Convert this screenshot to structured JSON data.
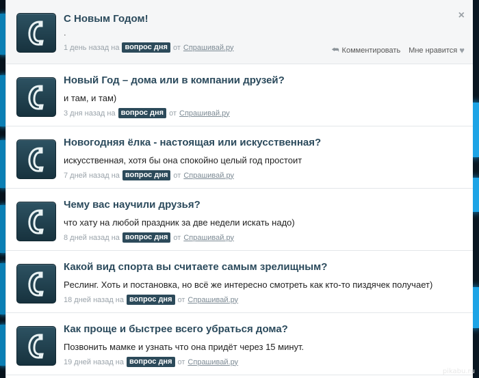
{
  "posts": [
    {
      "title": "С Новым Годом!",
      "answer": ".",
      "time": "1 день назад на",
      "tag": "вопрос дня",
      "from": "от",
      "source": "Спрашивай.ру",
      "close": "×",
      "comment_label": "Комментировать",
      "like_label": "Мне нравится"
    },
    {
      "title": "Новый Год – дома или в компании друзей?",
      "answer": "и там, и там)",
      "time": "3 дня назад на",
      "tag": "вопрос дня",
      "from": "от",
      "source": "Спрашивай.ру"
    },
    {
      "title": "Новогодняя ёлка - настоящая или искусственная?",
      "answer": "искусственная, хотя бы она спокойно целый год простоит",
      "time": "7 дней назад на",
      "tag": "вопрос дня",
      "from": "от",
      "source": "Спрашивай.ру"
    },
    {
      "title": "Чему вас научили друзья?",
      "answer": "что хату на любой праздник за две недели искать надо)",
      "time": "8 дней назад на",
      "tag": "вопрос дня",
      "from": "от",
      "source": "Спрашивай.ру"
    },
    {
      "title": "Какой вид спорта вы считаете самым зрелищным?",
      "answer": "Рeслинг. Хоть и постановка, но всё же интересно смотреть как кто-то пиздячек получает)",
      "time": "18 дней назад на",
      "tag": "вопрос дня",
      "from": "от",
      "source": "Спрашивай.ру"
    },
    {
      "title": "Как проще и быстрее всего убраться дома?",
      "answer": "Позвонить мамке и узнать что она придёт через 15 минут.",
      "time": "19 дней назад на",
      "tag": "вопрос дня",
      "from": "от",
      "source": "Спрашивай.ру"
    }
  ],
  "watermark": "pikabu.ru",
  "icons": {
    "avatar": "handset-logo-icon",
    "reply": "reply-arrow-icon",
    "heart": "heart-icon",
    "close": "close-icon"
  },
  "colors": {
    "title": "#2b4a5c",
    "tag_bg": "#2c4a5a",
    "avatar_bg": "#1f3f4d",
    "backdrop": "#06121c"
  }
}
